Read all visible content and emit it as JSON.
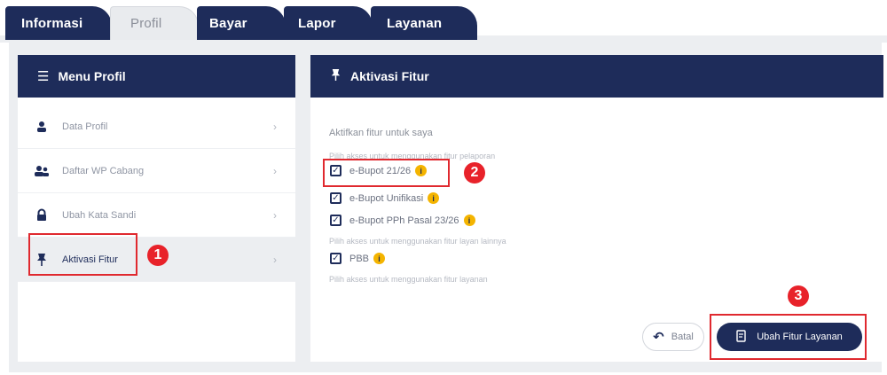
{
  "tabs": [
    {
      "label": "Informasi"
    },
    {
      "label": "Profil"
    },
    {
      "label": "Bayar"
    },
    {
      "label": "Lapor"
    },
    {
      "label": "Layanan"
    }
  ],
  "left_panel": {
    "title": "Menu Profil",
    "items": [
      {
        "label": "Data Profil",
        "icon": "user-icon"
      },
      {
        "label": "Daftar WP Cabang",
        "icon": "users-icon"
      },
      {
        "label": "Ubah Kata Sandi",
        "icon": "lock-icon"
      },
      {
        "label": "Aktivasi Fitur",
        "icon": "pin-icon"
      }
    ]
  },
  "right_panel": {
    "title": "Aktivasi Fitur",
    "intro": "Aktifkan fitur untuk saya",
    "hint_pelaporan": "Pilih akses untuk menggunakan fitur pelaporan",
    "hint_lainnya": "Pilih akses untuk menggunakan fitur layan lainnya",
    "hint_layanan": "Pilih akses untuk menggunakan fitur layanan",
    "features": [
      {
        "label": "e-Bupot 21/26",
        "checked": true
      },
      {
        "label": "e-Bupot Unifikasi",
        "checked": true
      },
      {
        "label": "e-Bupot PPh Pasal 23/26",
        "checked": true
      },
      {
        "label": "PBB",
        "checked": true
      }
    ],
    "cancel_label": "Batal",
    "save_label": "Ubah Fitur Layanan"
  },
  "markers": {
    "m1": "1",
    "m2": "2",
    "m3": "3"
  },
  "colors": {
    "navy": "#1e2c5a",
    "marker_red": "#e8222a",
    "info_yellow": "#f4b400"
  }
}
